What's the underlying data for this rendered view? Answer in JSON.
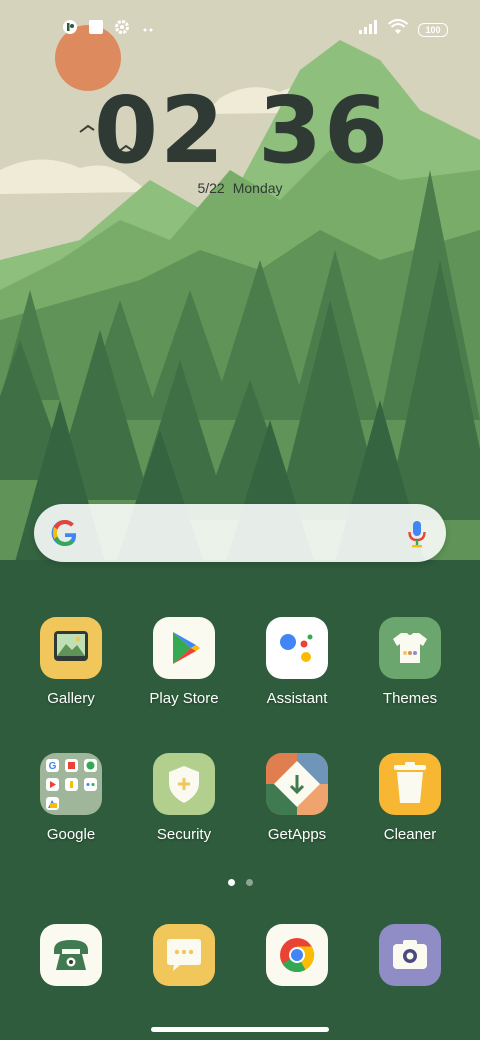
{
  "status_bar": {
    "battery": "100",
    "left_icons": [
      "app-notification-icon",
      "square-notification-icon",
      "settings-icon",
      "more-notifications-icon"
    ],
    "right_icons": [
      "signal-icon",
      "wifi-icon",
      "battery-icon"
    ]
  },
  "clock": {
    "hours": "02",
    "minutes": "36"
  },
  "date": {
    "day": "5/22",
    "weekday": "Monday"
  },
  "search": {
    "logo": "google-logo-icon",
    "voice": "microphone-icon"
  },
  "apps": [
    {
      "label": "Gallery",
      "icon": "gallery-icon",
      "color": "#f1c75b"
    },
    {
      "label": "Play Store",
      "icon": "play-store-icon",
      "color": "#fbfaf0"
    },
    {
      "label": "Assistant",
      "icon": "assistant-icon",
      "color": "#ffffff"
    },
    {
      "label": "Themes",
      "icon": "themes-icon",
      "color": "#6ba66e"
    },
    {
      "label": "Google",
      "icon": "google-folder-icon",
      "color": "#9fb69a"
    },
    {
      "label": "Security",
      "icon": "security-shield-icon",
      "color": "#b3cf8e"
    },
    {
      "label": "GetApps",
      "icon": "getapps-icon",
      "color": "#e59a5e"
    },
    {
      "label": "Cleaner",
      "icon": "cleaner-trash-icon",
      "color": "#f7b733"
    }
  ],
  "dock": [
    {
      "icon": "phone-icon",
      "color": "#fbfaf0"
    },
    {
      "icon": "messages-icon",
      "color": "#f1c75b"
    },
    {
      "icon": "chrome-icon",
      "color": "#fbfaf0"
    },
    {
      "icon": "camera-icon",
      "color": "#8f8cc6"
    }
  ],
  "page_indicator": {
    "pages": 2,
    "current": 1
  }
}
